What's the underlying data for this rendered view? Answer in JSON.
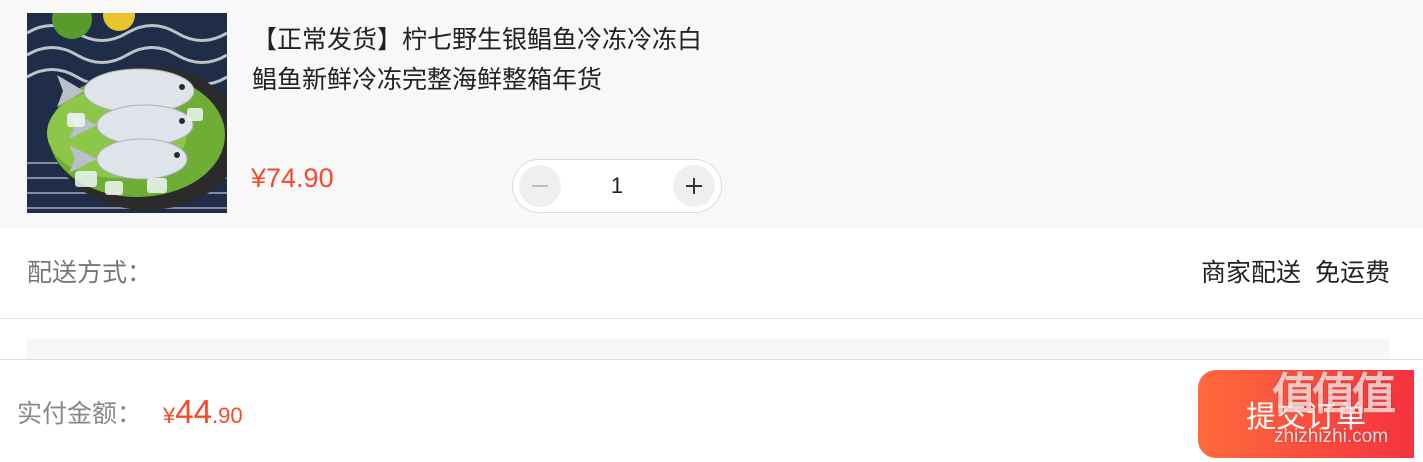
{
  "product": {
    "title": "【正常发货】柠七野生银鲳鱼冷冻冷冻白鲳鱼新鲜冷冻完整海鲜整箱年货",
    "price": "¥74.90",
    "image": "pomfret-fish-on-lettuce-and-ice",
    "quantity": "1",
    "decrement_icon": "minus-icon",
    "increment_icon": "plus-icon"
  },
  "delivery": {
    "label": "配送方式：",
    "method": "商家配送",
    "fee": "免运费"
  },
  "footer": {
    "total_label": "实付金额：",
    "total_currency": "¥",
    "total_integer": "44",
    "total_decimal": ".90",
    "submit_label": "提交订单"
  },
  "watermark": {
    "mark": "值值值",
    "domain": "zhizhizhi.com"
  },
  "colors": {
    "accent": "#f5492a",
    "button_gradient_start": "#ff6a3d",
    "button_gradient_end": "#f4333f",
    "card_background": "#f8f8f8"
  }
}
